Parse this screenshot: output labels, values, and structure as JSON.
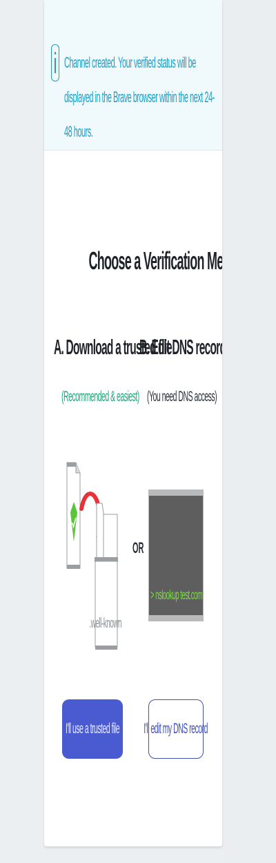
{
  "notice": {
    "message": "Channel created. Your verified status will be displayed in the Brave browser within the next 24-48 hours."
  },
  "verification": {
    "title": "Choose a Verification Method",
    "option_a": {
      "heading": "A. Download a trusted file",
      "note": "(Recommended & easiest)",
      "file_label": ".well-known",
      "button": "I'll use a trusted file"
    },
    "separator": "OR",
    "option_b": {
      "heading": "B. Edit DNS records",
      "note": "(You need DNS access)",
      "terminal_text": "> nslookup test.com",
      "button": "I'll edit my DNS record"
    }
  },
  "colors": {
    "accent": "#4a5ad0",
    "info": "#1ba1c8",
    "success": "#1aa87b",
    "terminal_text": "#7cd94a"
  }
}
